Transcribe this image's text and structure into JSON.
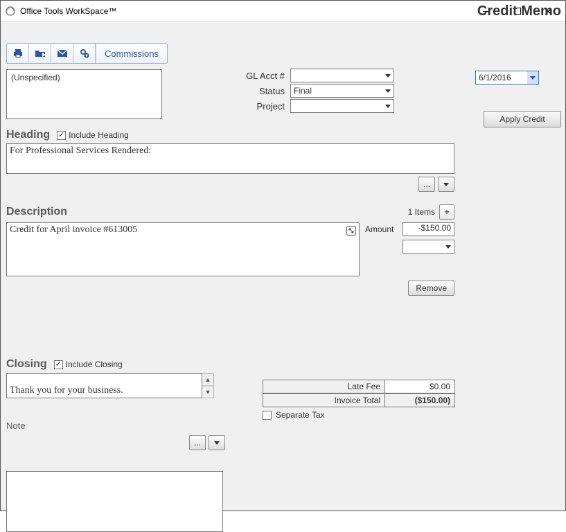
{
  "titlebar": {
    "app_title": "Office Tools WorkSpace™"
  },
  "page_title": "Credit Memo",
  "toolbar": {
    "commissions_label": "Commissions"
  },
  "recipient_box": "(Unspecified)",
  "gl_section": {
    "gl_label": "GL Acct #",
    "gl_value": "",
    "status_label": "Status",
    "status_value": "Final",
    "project_label": "Project",
    "project_value": ""
  },
  "date_field": "6/1/2016",
  "apply_credit_label": "Apply Credit",
  "heading_section": {
    "title": "Heading",
    "include_label": "Include Heading",
    "include_checked": true,
    "text": "For Professional Services Rendered:"
  },
  "description_section": {
    "title": "Description",
    "items_count_label": "1 Items",
    "amount_label": "Amount",
    "amount_value": "-$150.00",
    "remove_label": "Remove",
    "item": {
      "text": "Credit for April invoice #613005"
    }
  },
  "closing_section": {
    "title": "Closing",
    "include_label": "Include Closing",
    "include_checked": true,
    "text": "Thank you for your business."
  },
  "note_section": {
    "title": "Note"
  },
  "summary": {
    "late_fee_label": "Late Fee",
    "late_fee_value": "$0.00",
    "invoice_total_label": "Invoice Total",
    "invoice_total_value": "($150.00)",
    "separate_tax_label": "Separate Tax",
    "separate_tax_checked": false
  },
  "ellipsis": "..."
}
